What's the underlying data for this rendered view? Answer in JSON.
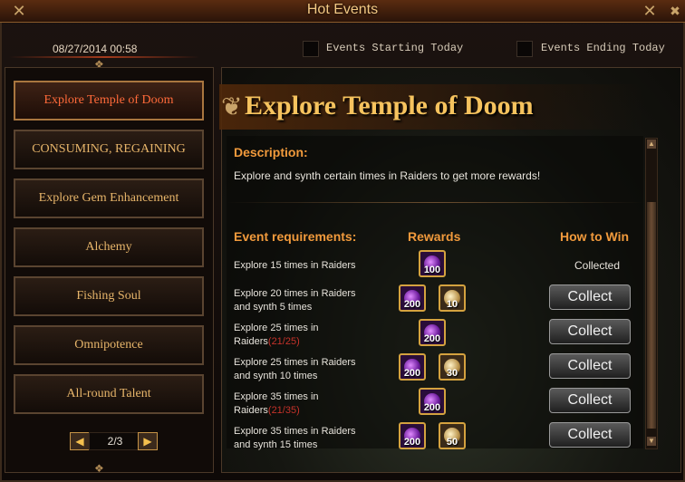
{
  "window": {
    "title": "Hot Events"
  },
  "header": {
    "datetime": "08/27/2014 00:58",
    "filters": [
      {
        "label": "Events Starting Today",
        "checked": false
      },
      {
        "label": "Events Ending Today",
        "checked": false
      }
    ]
  },
  "sidebar": {
    "items": [
      {
        "label": "Explore Temple of Doom",
        "active": true
      },
      {
        "label": "CONSUMING, REGAINING",
        "active": false
      },
      {
        "label": "Explore Gem Enhancement",
        "active": false
      },
      {
        "label": "Alchemy",
        "active": false
      },
      {
        "label": "Fishing Soul",
        "active": false
      },
      {
        "label": "Omnipotence",
        "active": false
      },
      {
        "label": "All-round Talent",
        "active": false
      }
    ],
    "pager": {
      "text": "2/3"
    }
  },
  "event": {
    "title": "Explore Temple of Doom",
    "description_heading": "Description:",
    "description": "Explore and synth certain times in Raiders to get more rewards!",
    "columns": {
      "requirements": "Event requirements:",
      "rewards": "Rewards",
      "how": "How to Win"
    },
    "rows": [
      {
        "line1": "Explore 15 times in Raiders",
        "line2": "",
        "progress": "",
        "rewards": [
          {
            "type": "purple",
            "qty": "100"
          }
        ],
        "status": "Collected"
      },
      {
        "line1": "Explore 20 times in Raiders",
        "line2": "and synth 5 times",
        "progress": "",
        "rewards": [
          {
            "type": "purple",
            "qty": "200"
          },
          {
            "type": "gold",
            "qty": "10"
          }
        ],
        "status": "Collect"
      },
      {
        "line1": "Explore 25 times in",
        "line2": "Raiders",
        "progress": "(21/25)",
        "rewards": [
          {
            "type": "purple",
            "qty": "200"
          }
        ],
        "status": "Collect"
      },
      {
        "line1": "Explore 25 times in Raiders",
        "line2": "and synth 10 times",
        "progress": "",
        "rewards": [
          {
            "type": "purple",
            "qty": "200"
          },
          {
            "type": "gold",
            "qty": "30"
          }
        ],
        "status": "Collect"
      },
      {
        "line1": "Explore 35 times in",
        "line2": "Raiders",
        "progress": "(21/35)",
        "rewards": [
          {
            "type": "purple",
            "qty": "200"
          }
        ],
        "status": "Collect"
      },
      {
        "line1": "Explore 35 times in Raiders",
        "line2": "and synth 15 times",
        "progress": "",
        "rewards": [
          {
            "type": "purple",
            "qty": "200"
          },
          {
            "type": "gold",
            "qty": "50"
          }
        ],
        "status": "Collect"
      }
    ]
  },
  "colors": {
    "accent": "#f19a3c",
    "active_tab": "#ff6a3a",
    "title_gold": "#f6c35e",
    "progress_red": "#c5322a"
  }
}
